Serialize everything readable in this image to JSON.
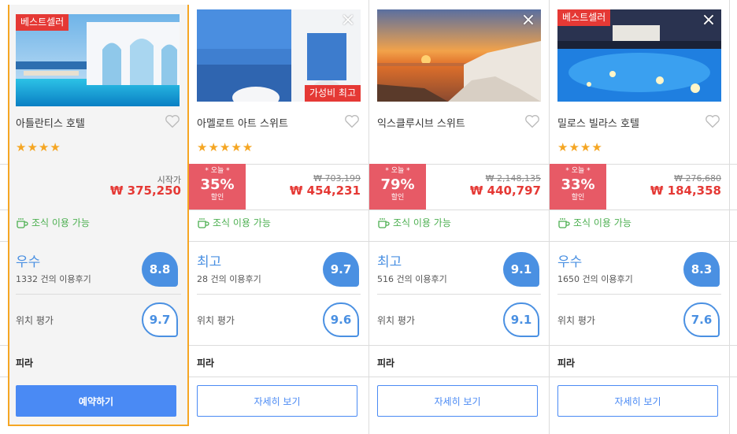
{
  "labels": {
    "start_price": "시작가",
    "today": "* 오늘 *",
    "off": "할인",
    "breakfast": "조식 이용 가능",
    "location_rating": "위치 평가",
    "review_suffix": "건의 이용후기",
    "bestseller": "베스트셀러",
    "value_best": "가성비 최고"
  },
  "hotels": [
    {
      "name": "아틀란티스 호텔",
      "stars": "★★★★",
      "badge": "베스트셀러",
      "price": "₩ 375,250",
      "review_word": "우수",
      "review_count": "1332 건의 이용후기",
      "score": "8.8",
      "location_score": "9.7",
      "area": "피라",
      "button": "예약하기"
    },
    {
      "name": "아멜로트 아트 스위트",
      "stars": "★★★★★",
      "badge": "가성비 최고",
      "discount": "35%",
      "old_price": "₩ 703,199",
      "price": "₩ 454,231",
      "review_word": "최고",
      "review_count": "28 건의 이용후기",
      "score": "9.7",
      "location_score": "9.6",
      "area": "피라",
      "button": "자세히 보기"
    },
    {
      "name": "익스클루시브 스위트",
      "stars": "",
      "discount": "79%",
      "old_price": "₩ 2,148,135",
      "price": "₩ 440,797",
      "review_word": "최고",
      "review_count": "516 건의 이용후기",
      "score": "9.1",
      "location_score": "9.1",
      "area": "피라",
      "button": "자세히 보기"
    },
    {
      "name": "밀로스 빌라스 호텔",
      "stars": "★★★★",
      "badge": "베스트셀러",
      "discount": "33%",
      "old_price": "₩ 276,680",
      "price": "₩ 184,358",
      "review_word": "우수",
      "review_count": "1650 건의 이용후기",
      "score": "8.3",
      "location_score": "7.6",
      "area": "피라",
      "button": "자세히 보기"
    }
  ],
  "icons": {
    "close": "close-icon",
    "heart": "heart-icon",
    "cup": "coffee-cup-icon",
    "star": "star-icon"
  },
  "colors": {
    "accent": "#4a90e2",
    "price_red": "#e53935",
    "discount_bg": "#e75a66",
    "breakfast_green": "#4caf50",
    "selected_border": "#f5a623",
    "star": "#f5a623"
  }
}
